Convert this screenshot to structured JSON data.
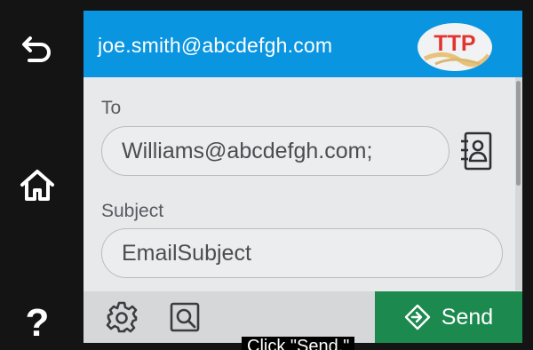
{
  "colors": {
    "header": "#0a95e1",
    "panel": "#e8e9ea",
    "bottom_bar": "#d6d7d9",
    "send": "#1c8a4f",
    "rail": "#141414",
    "logo_red": "#e3342f"
  },
  "rail": {
    "items": [
      {
        "name": "back",
        "icon": "back-arrow-icon"
      },
      {
        "name": "home",
        "icon": "home-icon"
      },
      {
        "name": "help",
        "icon": "help-icon"
      }
    ]
  },
  "header": {
    "from_email": "joe.smith@abcdefgh.com",
    "logo_text": "TTP"
  },
  "form": {
    "to_label": "To",
    "to_value": "Williams@abcdefgh.com;",
    "subject_label": "Subject",
    "subject_value": "EmailSubject"
  },
  "bottom_bar": {
    "settings_icon": "gear-icon",
    "preview_icon": "preview-icon",
    "send_label": "Send"
  },
  "caption": {
    "text": "Click \"Send.\""
  }
}
